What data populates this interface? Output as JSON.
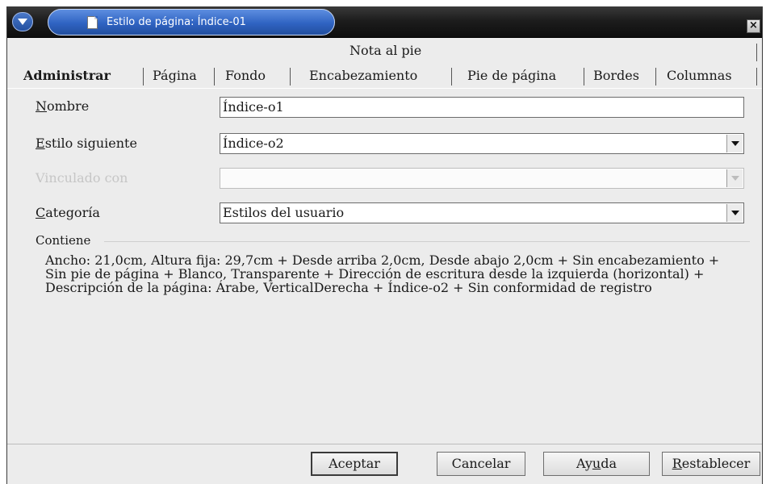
{
  "window": {
    "title": "Estilo de página: Índice-01"
  },
  "tabs": {
    "row1": [
      "Nota al pie"
    ],
    "row2": [
      "Administrar",
      "Página",
      "Fondo",
      "Encabezamiento",
      "Pie de página",
      "Bordes",
      "Columnas"
    ],
    "active": "Administrar"
  },
  "form": {
    "name": {
      "label_ul": "N",
      "label_rest": "ombre",
      "value": "Índice-o1"
    },
    "next_style": {
      "label_ul": "E",
      "label_rest": "stilo siguiente",
      "value": "Índice-o2"
    },
    "linked_with": {
      "label": "Vinculado con",
      "value": ""
    },
    "category": {
      "label_ul": "C",
      "label_rest": "ategoría",
      "value": "Estilos del usuario"
    }
  },
  "contains": {
    "label": "Contiene",
    "text": "Ancho: 21,0cm, Altura fija: 29,7cm + Desde arriba 2,0cm, Desde abajo 2,0cm + Sin encabezamiento + Sin pie de página + Blanco, Transparente + Dirección de escritura desde la izquierda (horizontal) + Descripción de la página:  Árabe, VerticalDerecha + Índice-o2 + Sin conformidad de registro"
  },
  "buttons": {
    "accept": "Aceptar",
    "cancel": "Cancelar",
    "help_pre": "Ay",
    "help_ul": "u",
    "help_post": "da",
    "reset_ul": "R",
    "reset_rest": "establecer"
  },
  "colors": {
    "title_pill": "#2f63c2",
    "title_bar": "#1d1d1d",
    "dialog_bg": "#ececec"
  },
  "icons": [
    "window-menu-icon",
    "document-icon",
    "close-icon",
    "dropdown-arrow-icon"
  ]
}
